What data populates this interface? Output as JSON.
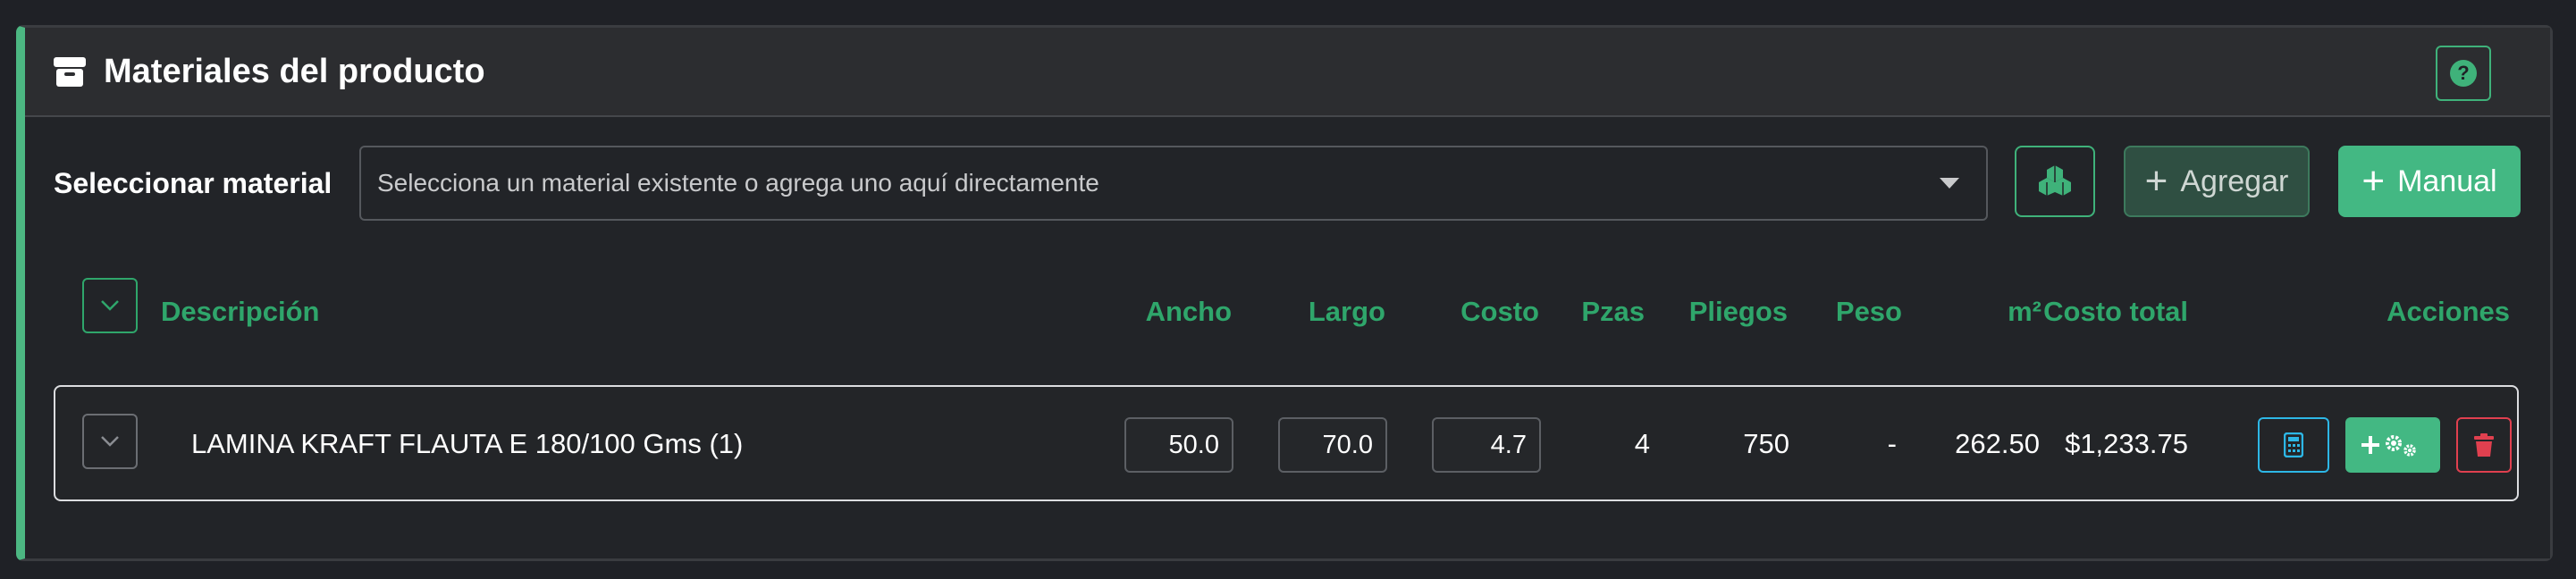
{
  "header": {
    "title": "Materiales del producto",
    "box_icon": "box-icon",
    "help_icon": "question-circle-icon"
  },
  "selector": {
    "label": "Seleccionar material",
    "placeholder": "Selecciona un material existente o agrega uno aquí directamente",
    "cubes_icon": "cubes-icon",
    "agregar_label": "Agregar",
    "manual_label": "Manual"
  },
  "table": {
    "columns": {
      "descripcion": "Descripción",
      "ancho": "Ancho",
      "largo": "Largo",
      "costo": "Costo",
      "pzas": "Pzas",
      "pliegos": "Pliegos",
      "peso": "Peso",
      "m2": "m²",
      "costo_total": "Costo total",
      "acciones": "Acciones"
    },
    "rows": [
      {
        "descripcion": "LAMINA KRAFT FLAUTA E 180/100 Gms (1)",
        "ancho": "50.0",
        "largo": "70.0",
        "costo": "4.7",
        "pzas": "4",
        "pliegos": "750",
        "peso": "-",
        "m2": "262.50",
        "costo_total": "$1,233.75"
      }
    ]
  },
  "colors": {
    "accent": "#43b883",
    "header_text": "#2fa66b",
    "info": "#2db7e6",
    "danger": "#e0404f"
  }
}
